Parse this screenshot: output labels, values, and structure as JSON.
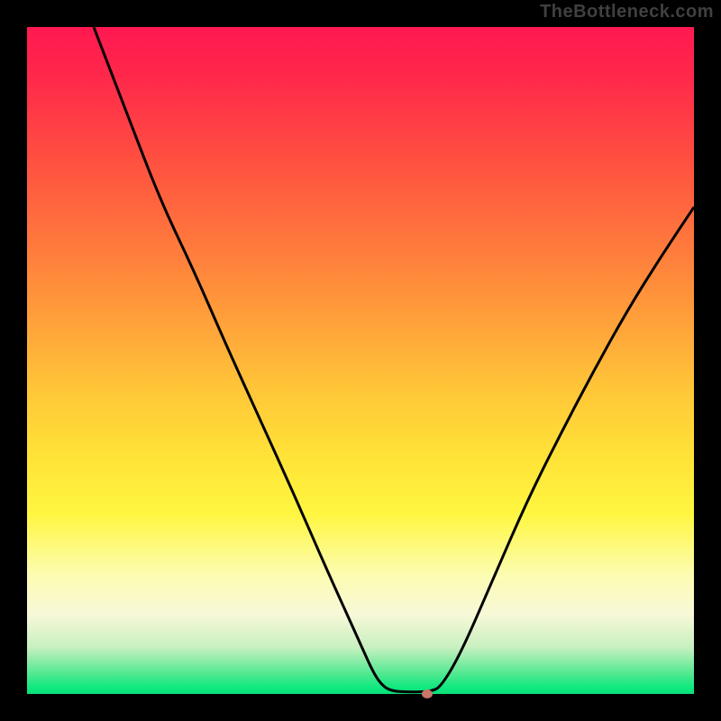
{
  "watermark": "TheBottleneck.com",
  "chart_data": {
    "type": "line",
    "title": "",
    "xlabel": "",
    "ylabel": "",
    "xlim": [
      0,
      100
    ],
    "ylim": [
      0,
      100
    ],
    "grid": false,
    "curve_points": [
      {
        "x": 10.0,
        "y": 100.0
      },
      {
        "x": 15.0,
        "y": 87.0
      },
      {
        "x": 20.0,
        "y": 74.0
      },
      {
        "x": 25.0,
        "y": 63.5
      },
      {
        "x": 30.0,
        "y": 52.0
      },
      {
        "x": 35.0,
        "y": 41.0
      },
      {
        "x": 40.0,
        "y": 30.0
      },
      {
        "x": 45.0,
        "y": 18.5
      },
      {
        "x": 50.0,
        "y": 7.5
      },
      {
        "x": 52.0,
        "y": 3.0
      },
      {
        "x": 53.5,
        "y": 1.0
      },
      {
        "x": 55.0,
        "y": 0.4
      },
      {
        "x": 57.0,
        "y": 0.3
      },
      {
        "x": 59.0,
        "y": 0.3
      },
      {
        "x": 60.5,
        "y": 0.4
      },
      {
        "x": 62.0,
        "y": 1.0
      },
      {
        "x": 65.0,
        "y": 6.0
      },
      {
        "x": 70.0,
        "y": 17.5
      },
      {
        "x": 75.0,
        "y": 29.0
      },
      {
        "x": 80.0,
        "y": 39.0
      },
      {
        "x": 85.0,
        "y": 48.5
      },
      {
        "x": 90.0,
        "y": 57.5
      },
      {
        "x": 95.0,
        "y": 65.5
      },
      {
        "x": 100.0,
        "y": 73.0
      }
    ],
    "marker": {
      "x": 60.0,
      "y": 0.0,
      "color": "#c97768"
    }
  }
}
